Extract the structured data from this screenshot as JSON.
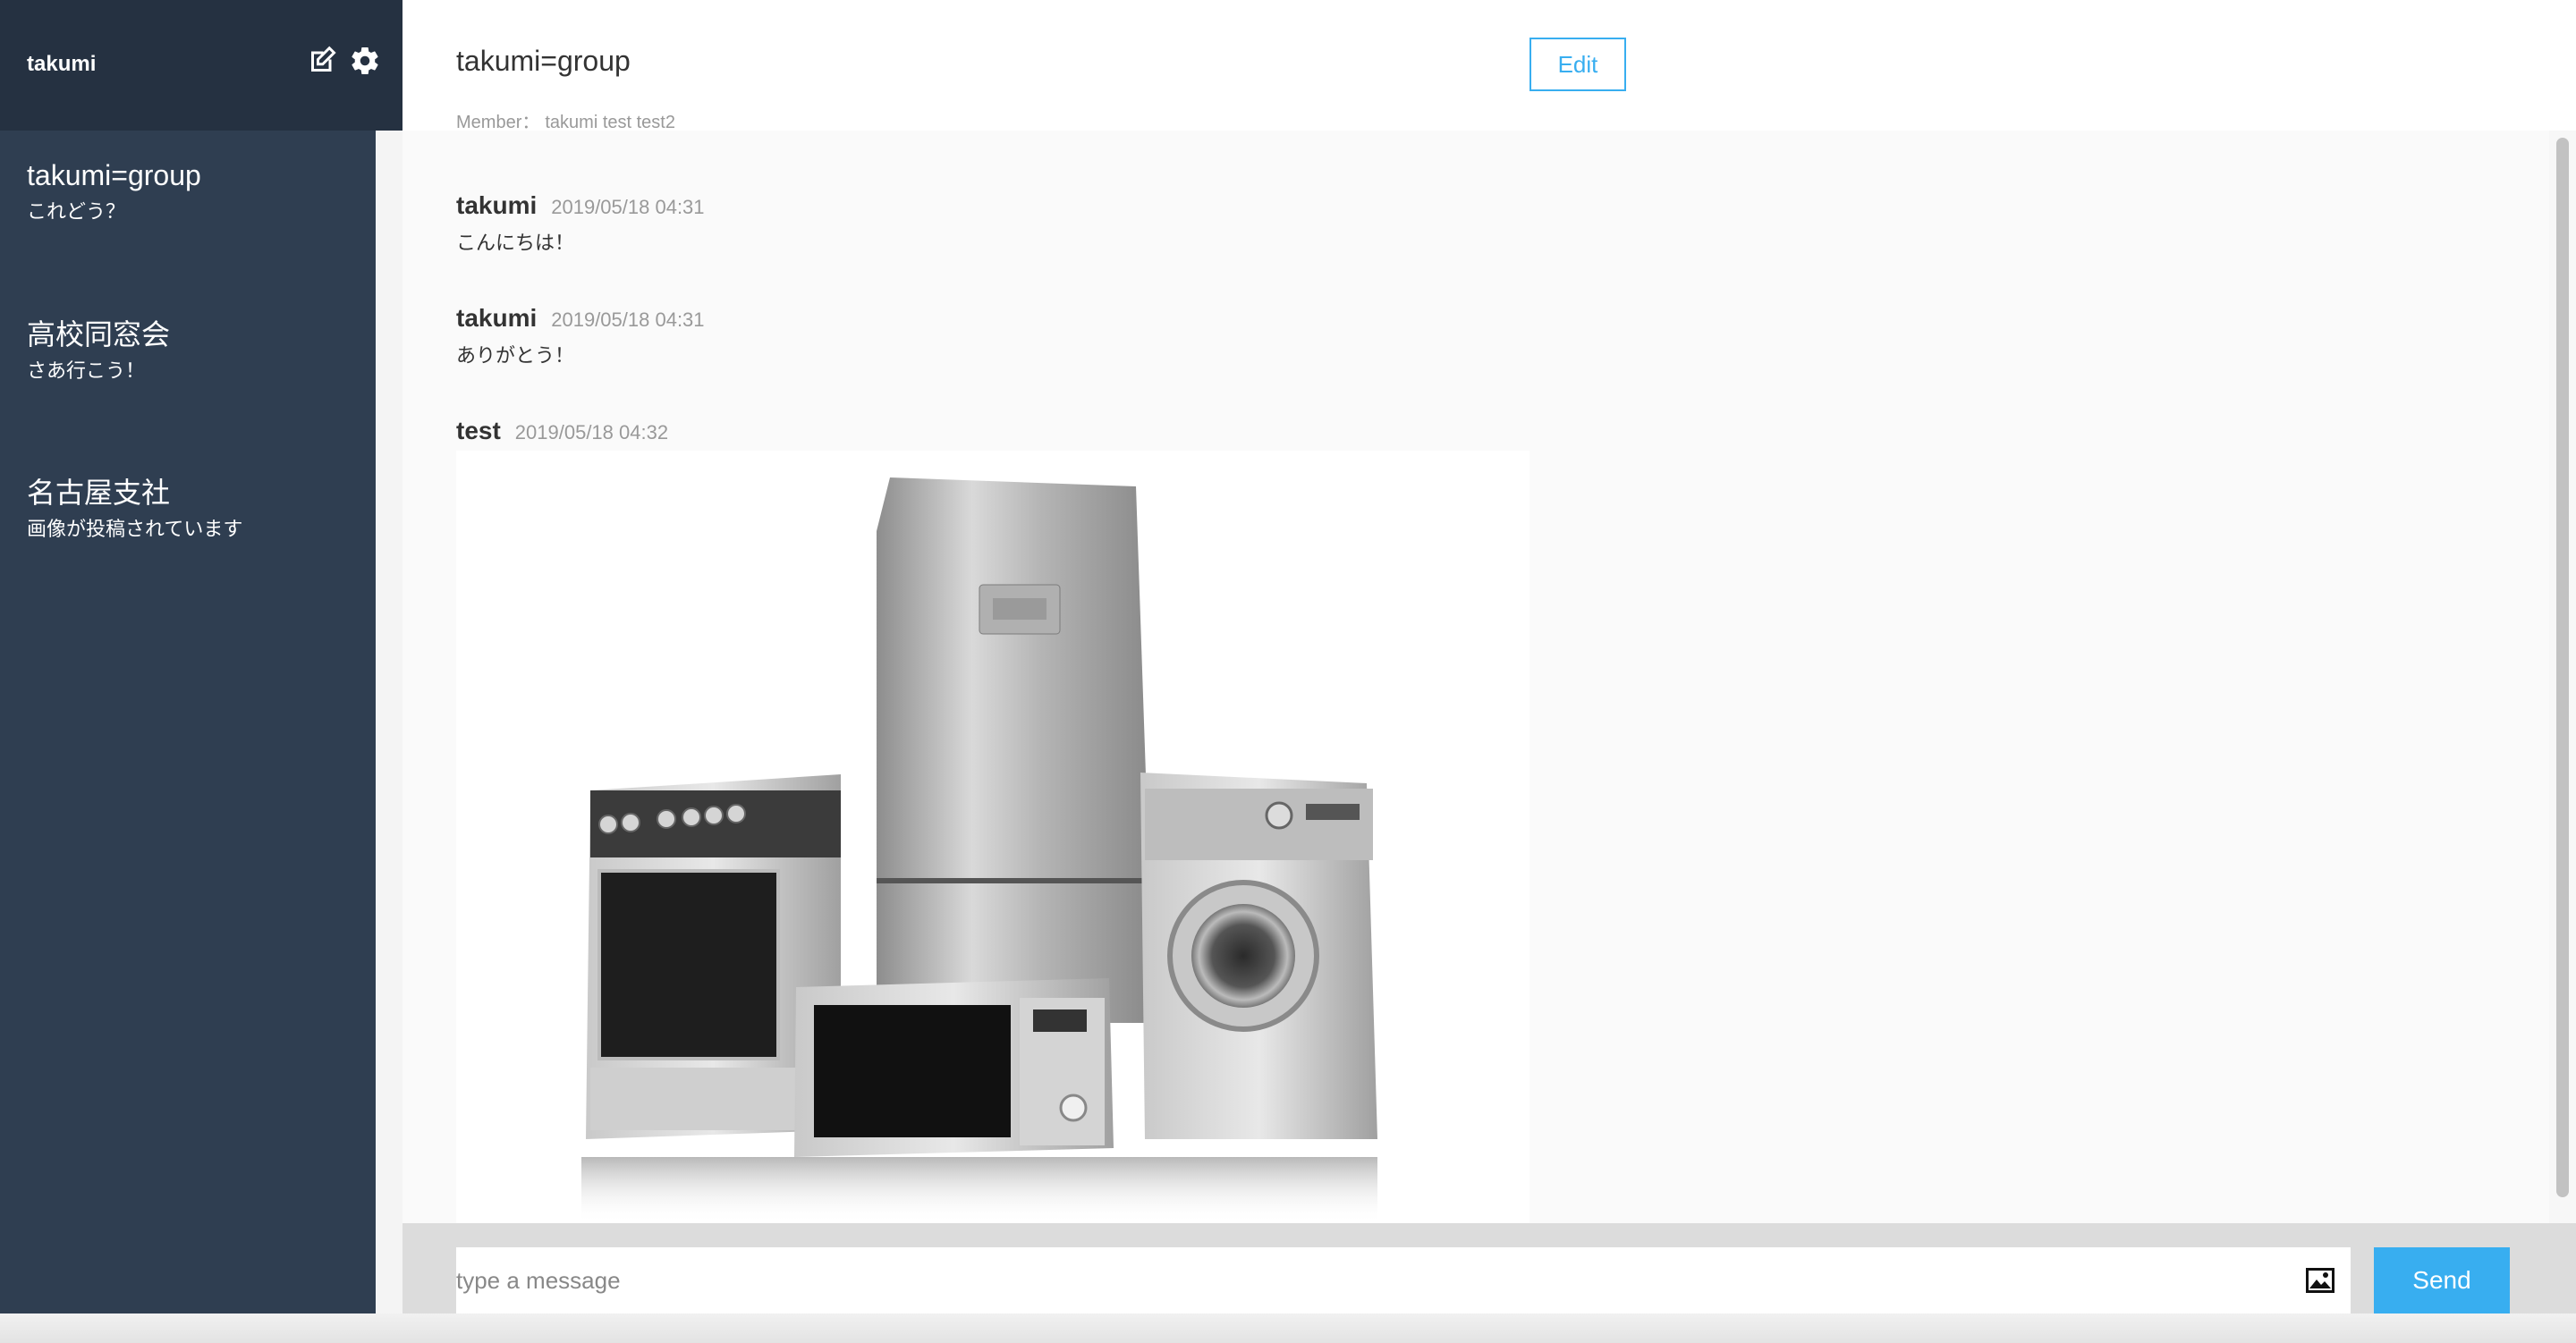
{
  "sidebar": {
    "user_name": "takumi",
    "groups": [
      {
        "name": "takumi=group",
        "last_message": "これどう？"
      },
      {
        "name": "高校同窓会",
        "last_message": "さあ行こう！"
      },
      {
        "name": "名古屋支社",
        "last_message": "画像が投稿されています"
      }
    ]
  },
  "chat": {
    "title": "takumi=group",
    "edit_label": "Edit",
    "member_label": "Member：",
    "members": "takumi test test2",
    "messages": [
      {
        "user": "takumi",
        "date": "2019/05/18 04:31",
        "text": "こんにちは！"
      },
      {
        "user": "takumi",
        "date": "2019/05/18 04:31",
        "text": "ありがとう！"
      },
      {
        "user": "test",
        "date": "2019/05/18 04:32",
        "image": "appliances-photo"
      }
    ]
  },
  "composer": {
    "placeholder": "type a message",
    "send_label": "Send"
  },
  "colors": {
    "sidebar_header": "#253141",
    "sidebar_body": "#2f3e51",
    "accent": "#38aef0"
  },
  "icons": [
    "edit-icon",
    "gear-icon",
    "image-upload-icon"
  ]
}
